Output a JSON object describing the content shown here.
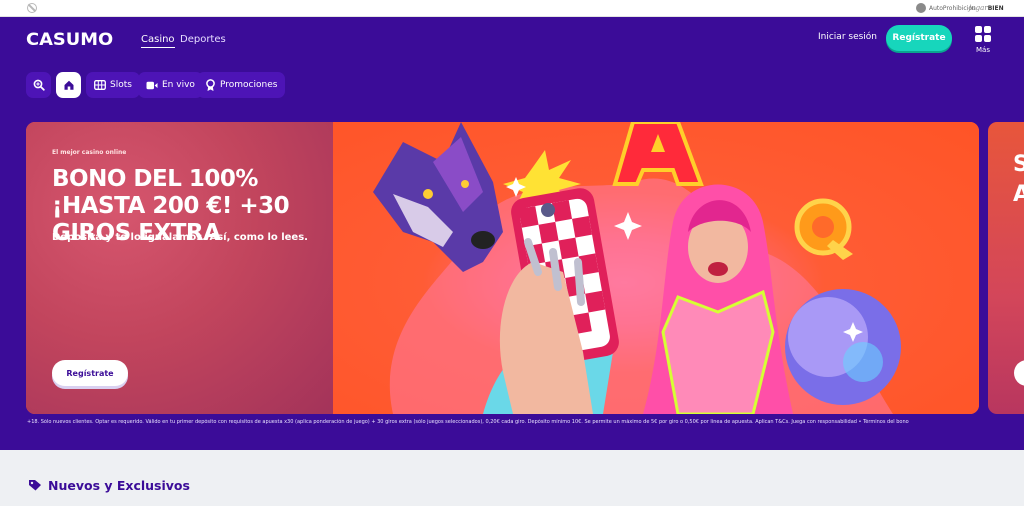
{
  "topbar": {
    "autoprohibicion": "AutoProhibición",
    "jugar": "jugar",
    "bien": "BIEN"
  },
  "header": {
    "logo": "CASUMO",
    "nav": [
      {
        "label": "Casino",
        "active": true
      },
      {
        "label": "Deportes",
        "active": false
      }
    ],
    "login": "Iniciar sesión",
    "register": "Regístrate",
    "more": "Más"
  },
  "subnav": {
    "items": [
      {
        "label": "",
        "icon": "search-icon"
      },
      {
        "label": "",
        "icon": "home-icon"
      },
      {
        "label": "Slots",
        "icon": "slots-icon"
      },
      {
        "label": "En vivo",
        "icon": "video-icon"
      },
      {
        "label": "Promociones",
        "icon": "badge-icon"
      }
    ]
  },
  "hero": {
    "eyebrow": "El mejor casino online",
    "title": "BONO DEL 100% ¡HASTA 200 €! +30 GIROS EXTRA",
    "subtitle": "Deposita y te lo igualamos. Así, como lo lees.",
    "button": "Regístrate",
    "peek_text": "S A"
  },
  "terms": "+18. Sólo nuevos clientes. Optar es requerido. Válido en tu primer depósito con requisitos de apuesta x30 (aplica ponderación de juego) + 30 giros extra (sólo juegos seleccionados), 0,20€ cada giro. Depósito mínimo 10€. Se permite un máximo de 5€ por giro o 0,50€ por línea de apuesta. Aplican T&Cs. Juega con responsabilidad • Términos del bono",
  "section": {
    "title": "Nuevos y Exclusivos"
  },
  "colors": {
    "brand_purple": "#3b0c98",
    "accent_teal": "#17d6bc",
    "hero_orange": "#ff5426"
  }
}
